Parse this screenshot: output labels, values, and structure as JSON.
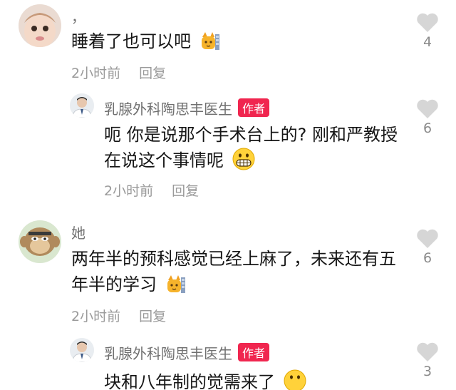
{
  "comments": [
    {
      "username": "，",
      "text": "睡着了也可以吧",
      "time": "2小时前",
      "reply_label": "回复",
      "likes": "4",
      "emoji": "cat-cheers-emoji"
    },
    {
      "username": "乳腺外科陶思丰医生",
      "author_tag": "作者",
      "text_line1": "呃 你是说那个手术台上的? 刚和严教授",
      "text_line2": "在说这个事情呢",
      "time": "2小时前",
      "reply_label": "回复",
      "likes": "6",
      "emoji": "grin-emoji"
    },
    {
      "username": "她",
      "text_line1": "两年半的预科感觉已经上麻了，未来还有五",
      "text_line2": "年半的学习",
      "time": "2小时前",
      "reply_label": "回复",
      "likes": "6",
      "emoji": "cat-cheers-emoji"
    },
    {
      "username": "乳腺外科陶思丰医生",
      "author_tag": "作者",
      "text_partial": "块和八年制的觉需来了",
      "likes": "3"
    }
  ],
  "colors": {
    "author_tag_bg": "#f0264f",
    "muted_text": "#9a9a9a",
    "heart": "#d6d6d6"
  }
}
